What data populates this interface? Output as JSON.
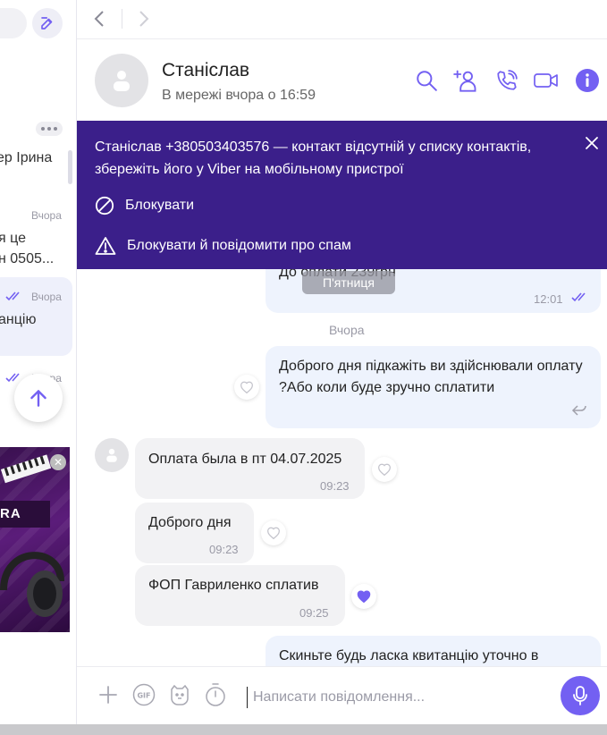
{
  "sidebar": {
    "items": [
      {
        "text": "ер Ірина"
      },
      {
        "time": "Вчора",
        "line1": "я це",
        "line2": "н 0505..."
      },
      {
        "time": "Вчора",
        "text": "анцію"
      },
      {
        "time": "Вчора"
      }
    ],
    "ad": {
      "text": "RA"
    }
  },
  "header": {
    "name": "Станіслав",
    "status": "В мережі вчора о 16:59"
  },
  "banner": {
    "message": "Станіслав +380503403576 — контакт відсутній у списку контактів, збережіть його у Viber на мобільному пристрої",
    "block_label": "Блокувати",
    "report_label": "Блокувати й повідомити про спам"
  },
  "messages": [
    {
      "dir": "out",
      "text": "До оплати 239грн",
      "time": "12:01"
    },
    {
      "dir": "out",
      "text": "Доброго дня підкажіть ви здійснювали оплату ?Або коли буде зручно сплатити",
      "time": ""
    },
    {
      "dir": "in",
      "text": "Оплата была в пт 04.07.2025",
      "time": "09:23"
    },
    {
      "dir": "in",
      "text": "Доброго дня",
      "time": "09:23"
    },
    {
      "dir": "in",
      "text": "ФОП Гавриленко сплатив",
      "time": "09:25"
    },
    {
      "dir": "out",
      "text": "Скиньте будь ласка квитанцію уточно в"
    }
  ],
  "day_chip": "П'ятниця",
  "date_label": "Вчора",
  "composer": {
    "placeholder": "Написати повідомлення..."
  },
  "colors": {
    "accent": "#7360f2",
    "banner": "#3b1f8a",
    "out_bubble": "#eef3fd",
    "in_bubble": "#f2f2f4"
  }
}
